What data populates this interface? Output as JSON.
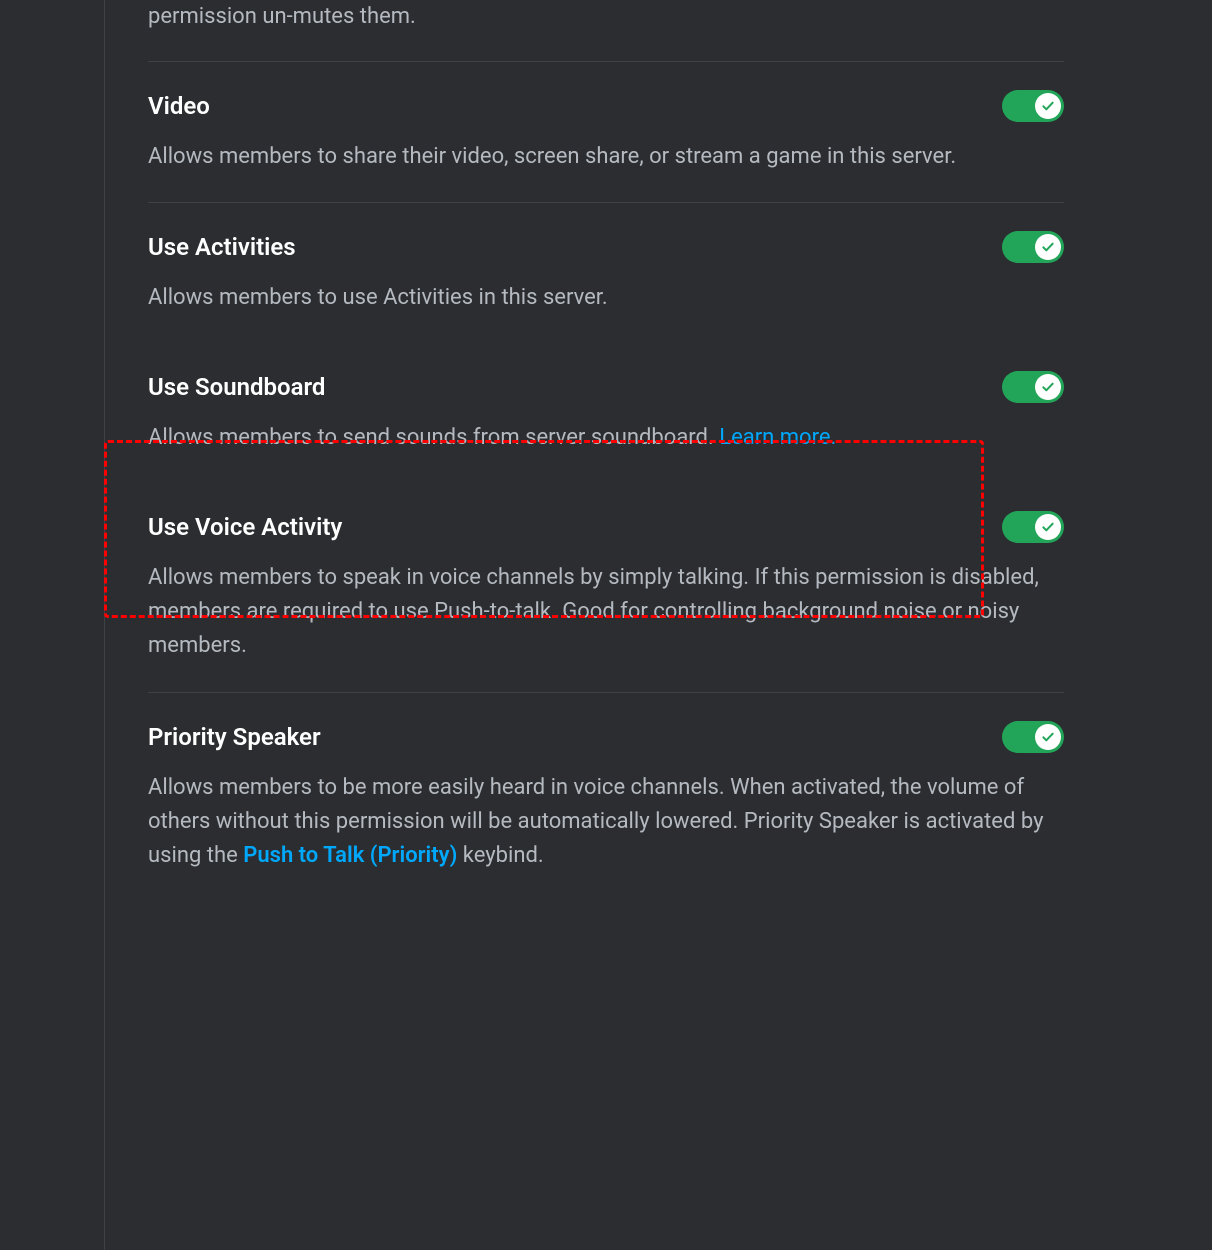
{
  "intro": {
    "text": "permission un-mutes them."
  },
  "permissions": [
    {
      "title": "Video",
      "description": "Allows members to share their video, screen share, or stream a game in this server.",
      "enabled": true,
      "link": null
    },
    {
      "title": "Use Activities",
      "description": "Allows members to use Activities in this server.",
      "enabled": true,
      "link": null,
      "noBorder": true
    },
    {
      "title": "Use Soundboard",
      "description": "Allows members to send sounds from server soundboard. ",
      "enabled": true,
      "link": "Learn more.",
      "noBorder": true
    },
    {
      "title": "Use Voice Activity",
      "description": "Allows members to speak in voice channels by simply talking. If this permission is disabled, members are required to use Push-to-talk. Good for controlling background noise or noisy members.",
      "enabled": true,
      "link": null
    },
    {
      "title": "Priority Speaker",
      "descriptionPre": "Allows members to be more easily heard in voice channels. When activated, the volume of others without this permission will be automatically lowered. Priority Speaker is activated by using the ",
      "linkBold": "Push to Talk (Priority)",
      "descriptionPost": " keybind.",
      "enabled": true
    }
  ]
}
